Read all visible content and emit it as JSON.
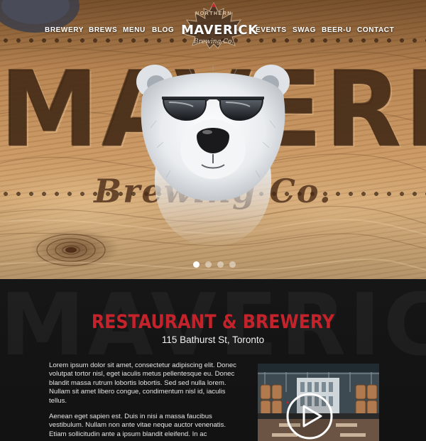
{
  "nav": {
    "left": [
      "BREWERY",
      "BREWS",
      "MENU",
      "BLOG"
    ],
    "right": [
      "EVENTS",
      "SWAG",
      "BEER-U",
      "CONTACT"
    ]
  },
  "logo": {
    "top": "NORTHERN",
    "main": "MAVERICK",
    "sub": "Brewing Co."
  },
  "hero": {
    "engraved_word": "MAVERICK",
    "engraved_script": "Brewing Co."
  },
  "slider": {
    "count": 4,
    "active": 0
  },
  "section": {
    "background_word": "MAVERICK",
    "title": "RESTAURANT & BREWERY",
    "address": "115 Bathurst St, Toronto",
    "paragraph1": "Lorem ipsum dolor sit amet, consectetur adipiscing elit. Donec volutpat tortor nisl, eget iaculis metus pellentesque eu. Donec blandit massa rutrum lobortis lobortis. Sed sed nulla lorem. Nullam sit amet libero congue, condimentum nisl id, iaculis tellus.",
    "paragraph2": "Aenean eget sapien est. Duis in nisi a massa faucibus vestibulum. Nullam non ante vitae neque auctor venenatis. Etiam sollicitudin ante a ipsum blandit eleifend. In ac"
  },
  "colors": {
    "accent_red": "#c4232b",
    "nav_text": "#ffffff",
    "dark_bg": "#141414"
  },
  "icons": {
    "play": "play-icon",
    "bear": "polar-bear-sunglasses-image",
    "logo_leaf": "maple-leaf-icon"
  }
}
